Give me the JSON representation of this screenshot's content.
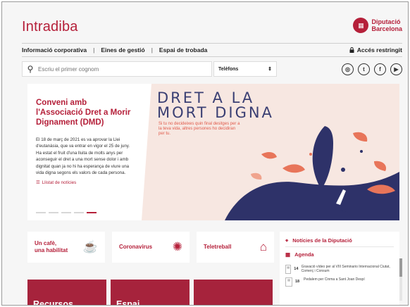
{
  "header": {
    "brand": "Intradiba",
    "logo_line1": "Diputació",
    "logo_line2": "Barcelona"
  },
  "nav": {
    "items": [
      "Informació corporativa",
      "Eines de gestió",
      "Espai de trobada"
    ],
    "restricted": "Accés restringit"
  },
  "search": {
    "placeholder": "Escriu el primer cognom",
    "select_value": "Telèfons"
  },
  "social": [
    "instagram-icon",
    "twitter-icon",
    "facebook-icon",
    "youtube-icon"
  ],
  "hero": {
    "title": "Conveni amb l'Associació Dret a Morir Dignament (DMD)",
    "body": "El 18 de març de 2021 es va aprovar la Llei d'eutanàsia, que va entrar en vigor el 25 de juny. Ha estat el fruit d'una lluita de molts anys per aconseguir el dret a una mort sense dolor i amb dignitat quan ja no hi ha esperança de viure una vida digna segons els valors de cada persona.",
    "link": "Llistat de notícies",
    "headline_line1": "DRET A LA",
    "headline_line2": "MORT DIGNA",
    "subline": "Si tu no decideixes quin final desitges per a la teva vida, altres persones ho decidiran per tu.",
    "slides": 5,
    "active_slide": 5
  },
  "cards": [
    {
      "label_line1": "Un cafè,",
      "label_line2": "una habilitat",
      "icon": "coffee-cup-icon"
    },
    {
      "label_line1": "Coronavirus",
      "label_line2": "",
      "icon": "virus-icon"
    },
    {
      "label_line1": "Teletreball",
      "label_line2": "",
      "icon": "home-office-icon"
    }
  ],
  "tiles": [
    "Recursos",
    "Espai",
    ""
  ],
  "news": {
    "title": "Notícies de la Diputació",
    "agenda_title": "Agenda",
    "events": [
      {
        "day": "14",
        "text": "Gravació vídeo per al VIII Seminario Internacional Ciutat, Comerç i Consum"
      },
      {
        "day": "18",
        "text": "Pedalem per Cinma a Sant Joan Despí"
      }
    ]
  },
  "colors": {
    "brand": "#b5203a",
    "tile": "#a6233c",
    "navy": "#2e3269",
    "coral": "#e8755a"
  }
}
